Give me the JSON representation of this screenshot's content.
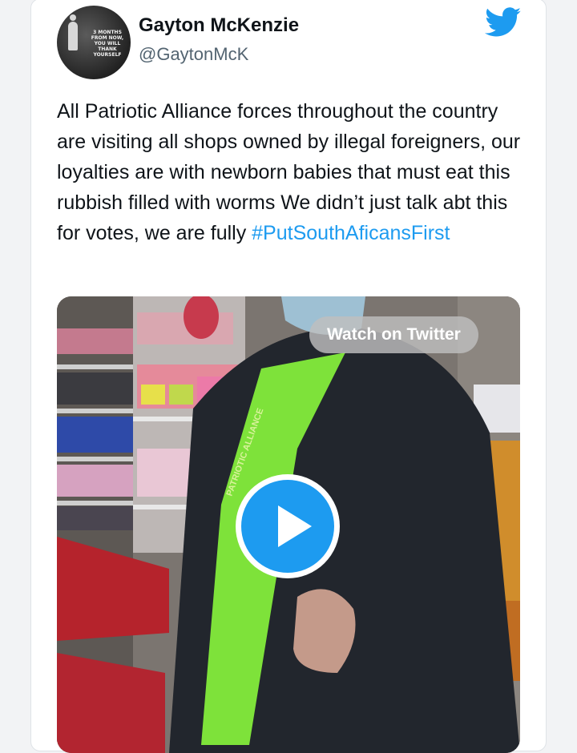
{
  "tweet": {
    "author_name": "Gayton McKenzie",
    "author_handle": "@GaytonMcK",
    "avatar_text": "3 MONTHS FROM NOW, YOU WILL THANK YOURSELF",
    "text_main": "All Patriotic Alliance forces throughout the country are visiting all shops owned by illegal foreigners, our loyalties are with newborn babies that must eat this rubbish filled with worms We didn’t just talk abt this for votes, we are fully ",
    "hashtag": "#PutSouthAficansFirst"
  },
  "media": {
    "watch_label": "Watch on Twitter",
    "shirt_text": "PATRIOTIC ALLIANCE"
  },
  "icons": {
    "bird": "twitter-bird-icon",
    "play": "play-icon"
  },
  "colors": {
    "brand_blue": "#1d9bf0",
    "text": "#0f1419",
    "secondary_text": "#536471"
  }
}
